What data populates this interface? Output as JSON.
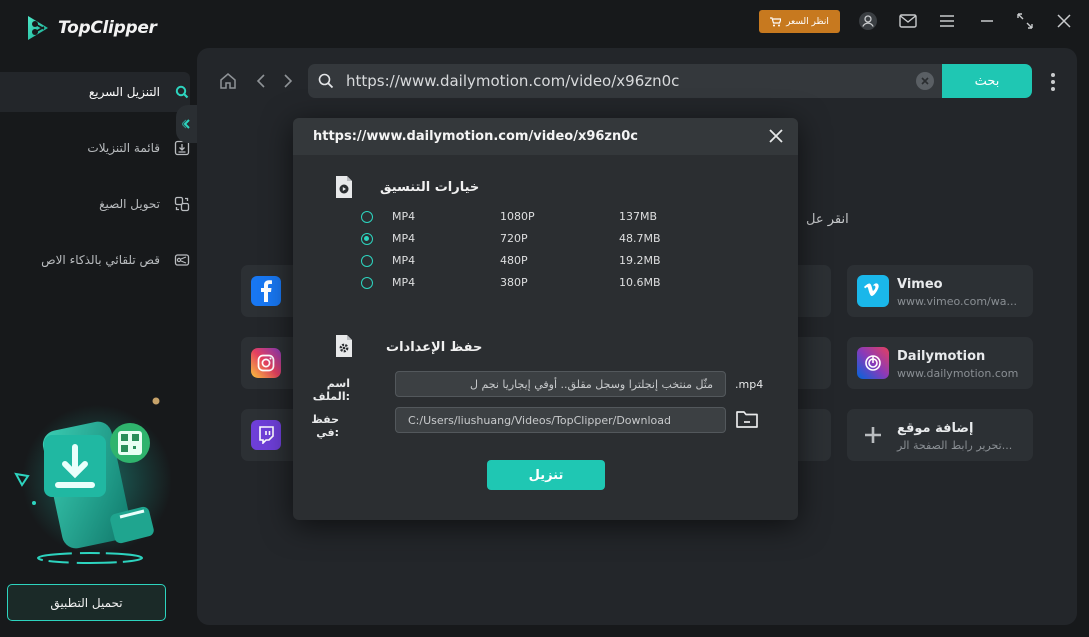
{
  "app": {
    "name": "TopClipper",
    "price_button": "انظر السعر"
  },
  "sidebar": {
    "items": [
      {
        "label": "التنزيل السريع",
        "icon": "search-icon",
        "active": true
      },
      {
        "label": "قائمة التنزيلات",
        "icon": "download-list-icon",
        "active": false
      },
      {
        "label": "تحويل الصيغ",
        "icon": "convert-icon",
        "active": false
      },
      {
        "label": "قص تلقائي بالذكاء الاص",
        "icon": "video-cut-icon",
        "active": false
      }
    ],
    "install_button": "تحميل التطبيق"
  },
  "browser": {
    "url": "https://www.dailymotion.com/video/x96zn0c",
    "search_button": "بحث",
    "hint": "انقر عل"
  },
  "sites": [
    {
      "name": "Vimeo",
      "url": "www.vimeo.com/wa...",
      "icon": "vimeo-icon"
    },
    {
      "name": "Dailymotion",
      "url": "www.dailymotion.com",
      "icon": "dailymotion-icon"
    },
    {
      "name": "إضافة موقع",
      "url": "تحرير رابط الصفحة الر...",
      "icon": "plus-icon"
    }
  ],
  "dialog": {
    "title": "https://www.dailymotion.com/video/x96zn0c",
    "format_section_title": "خيارات التنسيق",
    "formats": [
      {
        "format": "MP4",
        "resolution": "1080P",
        "size": "137MB",
        "selected": false
      },
      {
        "format": "MP4",
        "resolution": "720P",
        "size": "48.7MB",
        "selected": true
      },
      {
        "format": "MP4",
        "resolution": "480P",
        "size": "19.2MB",
        "selected": false
      },
      {
        "format": "MP4",
        "resolution": "380P",
        "size": "10.6MB",
        "selected": false
      }
    ],
    "save_section_title": "حفظ الإعدادات",
    "filename_label": "اسم الملف:",
    "filename_value": "مثّل منتخب إنجلترا وسجل مقلق.. أوفي إيجاريا نجم ل",
    "extension": ".mp4",
    "save_to_label": "حفظ في:",
    "save_to_value": "C:/Users/liushuang/Videos/TopClipper/Download",
    "download_button": "تنزيل"
  },
  "colors": {
    "accent": "#1fc7b3",
    "price": "#c7791f",
    "background": "#17191b",
    "panel": "#23262a"
  }
}
